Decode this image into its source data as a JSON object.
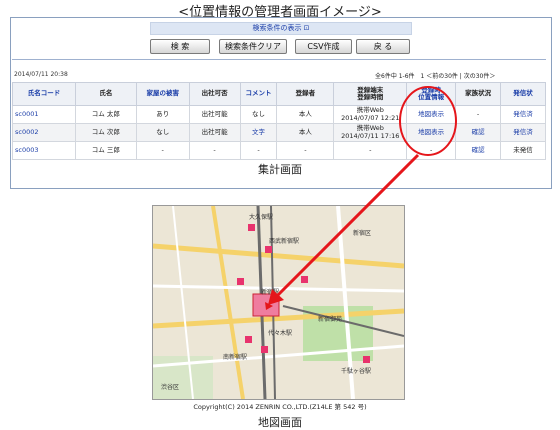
{
  "page_title": "<位置情報の管理者画面イメージ>",
  "search_toggle": "検索条件の表示 ⊡",
  "buttons": {
    "search": "検 索",
    "clear": "検索条件クリア",
    "csv": "CSV作成",
    "back": "戻 る"
  },
  "date_time": "2014/07/11 20:38",
  "pager": "全6件中 1-6件　1 ＜前の30件 | 次の30件＞",
  "table": {
    "headers": [
      "氏名コード",
      "氏名",
      "家屋の被害",
      "出社可否",
      "コメント",
      "登録者",
      "登録端末\n登録時間",
      "登録時\n位置情報",
      "家族状況",
      "発信状"
    ],
    "rows": [
      [
        "sc0001",
        "コム 太郎",
        "あり",
        "出社可能",
        "なし",
        "本人",
        "携帯Web\n2014/07/07 12:21",
        "地図表示",
        "-",
        "発信済"
      ],
      [
        "sc0002",
        "コム 次郎",
        "なし",
        "出社可能",
        "文字",
        "本人",
        "携帯Web\n2014/07/11 17:16",
        "地図表示",
        "確認",
        "発信済"
      ],
      [
        "sc0003",
        "コム 三郎",
        "-",
        "-",
        "-",
        "-",
        "-",
        "-",
        "確認",
        "未発信"
      ]
    ]
  },
  "summary_caption": "集計画面",
  "map": {
    "labels": [
      "大久保駅",
      "西武新宿駅",
      "新宿駅",
      "代々木駅",
      "南新宿駅",
      "千駄ヶ谷駅",
      "新宿御苑",
      "渋谷区",
      "新宿区"
    ]
  },
  "copyright": "Copyright(C) 2014 ZENRIN CO.,LTD.(Z14LE 第 542 号)",
  "map_caption": "地図画面",
  "colors": {
    "link": "#1c3ea8",
    "highlight": "#e5161b",
    "station": "#e8336d"
  }
}
